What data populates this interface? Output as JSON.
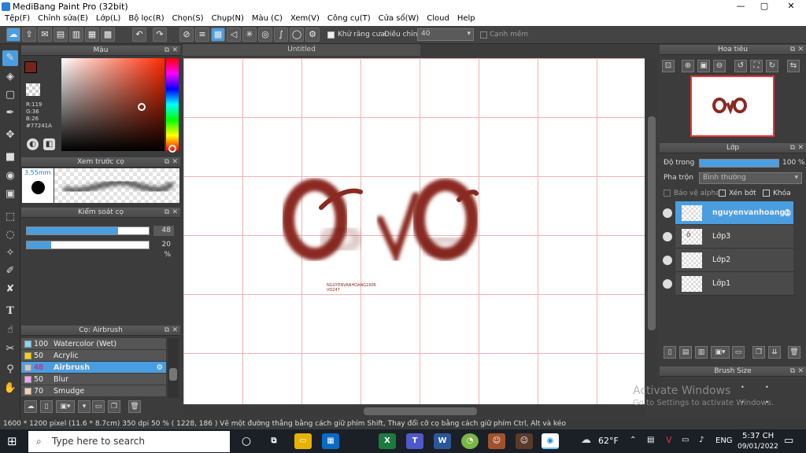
{
  "window": {
    "title": "MediBang Paint Pro (32bit)",
    "minimize": "—",
    "maximize": "▢",
    "close": "✕"
  },
  "menu": [
    "Tệp(F)",
    "Chỉnh sửa(E)",
    "Lớp(L)",
    "Bộ lọc(R)",
    "Chọn(S)",
    "Chụp(N)",
    "Màu (C)",
    "Xem(V)",
    "Công cụ(T)",
    "Cửa sổ(W)",
    "Cloud",
    "Help"
  ],
  "toolbar": {
    "antialias_label": "Khử răng cưa",
    "adjust_label": "Điều chỉnh",
    "adjust_value": "40",
    "edge_label": "Cạnh mềm"
  },
  "color_panel": {
    "title": "Màu",
    "r": "R:119",
    "g": "G:36",
    "b": "B:26",
    "hex": "#77241A",
    "current_color": "#77241A"
  },
  "brush_preview": {
    "title": "Xem trước cọ",
    "size": "3.55mm"
  },
  "brush_control": {
    "title": "Kiểm soát cọ",
    "size_value": "48",
    "size_fraction": 0.75,
    "opacity_value": "20 %",
    "opacity_fraction": 0.2
  },
  "brush_list": {
    "title": "Cọ: Airbrush",
    "items": [
      {
        "size": "100",
        "name": "Watercolor (Wet)",
        "color": "#7fd8f5"
      },
      {
        "size": "50",
        "name": "Acrylic",
        "color": "#f5d400"
      },
      {
        "size": "48",
        "name": "Airbrush",
        "color": "#c8c8c8",
        "selected": true
      },
      {
        "size": "50",
        "name": "Blur",
        "color": "#f5a0f0"
      },
      {
        "size": "70",
        "name": "Smudge",
        "color": "#f5d0b0"
      }
    ]
  },
  "canvas": {
    "tab": "Untitled",
    "signature_line1": "NGUYENVANHOANG1606",
    "signature_line2": "VD247"
  },
  "status": {
    "text": "1600 * 1200 pixel   (11.6 * 8.7cm)   350 dpi   50 %   ( 1228, 186 )   Vẽ một đường thẳng bằng cách giữ phím Shift, Thay đổi cỡ cọ bằng cách giữ phím Ctrl, Alt và kéo"
  },
  "navigator": {
    "title": "Hoa tiêu"
  },
  "layers": {
    "title": "Lớp",
    "opacity_label": "Độ trong",
    "opacity_value": "100 %",
    "opacity_fraction": 1.0,
    "blend_label": "Pha trộn",
    "blend_value": "Bình thường",
    "protect_alpha": "Bảo vệ alpha",
    "clipping": "Xén bớt",
    "lock": "Khóa",
    "items": [
      {
        "name": "nguyenvanhoang1",
        "selected": true
      },
      {
        "name": "Lớp3"
      },
      {
        "name": "Lớp2"
      },
      {
        "name": "Lớp1"
      }
    ]
  },
  "brush_size": {
    "title": "Brush Size"
  },
  "watermark": {
    "line1": "Activate Windows",
    "line2": "Go to Settings to activate Windows."
  },
  "taskbar": {
    "search_placeholder": "Type here to search",
    "weather": "62°F",
    "lang": "ENG",
    "time": "5:37 CH",
    "date": "09/01/2022"
  }
}
